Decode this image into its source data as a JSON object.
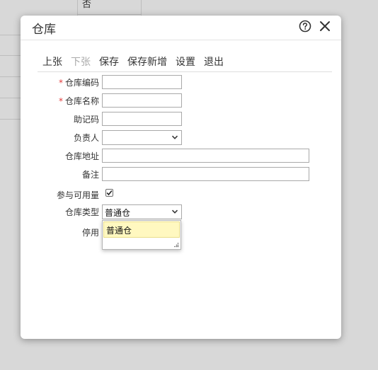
{
  "background": {
    "cell_text": "否"
  },
  "dialog": {
    "title": "仓库",
    "help_icon": "help-circle-icon",
    "close_icon": "close-icon"
  },
  "toolbar": {
    "prev": "上张",
    "next": "下张",
    "save": "保存",
    "save_new": "保存新增",
    "settings": "设置",
    "exit": "退出"
  },
  "form": {
    "code_label": "仓库编码",
    "code_value": "",
    "name_label": "仓库名称",
    "name_value": "",
    "mnemonic_label": "助记码",
    "mnemonic_value": "",
    "manager_label": "负责人",
    "manager_value": "",
    "address_label": "仓库地址",
    "address_value": "",
    "remark_label": "备注",
    "remark_value": "",
    "available_label": "参与可用量",
    "available_checked": true,
    "type_label": "仓库类型",
    "type_value": "普通仓",
    "disabled_label": "停用"
  },
  "dropdown": {
    "options": [
      "普通仓"
    ]
  },
  "colors": {
    "required": "#e23b3b",
    "highlight": "#fff8c0",
    "disabled_text": "#aaaaaa"
  }
}
